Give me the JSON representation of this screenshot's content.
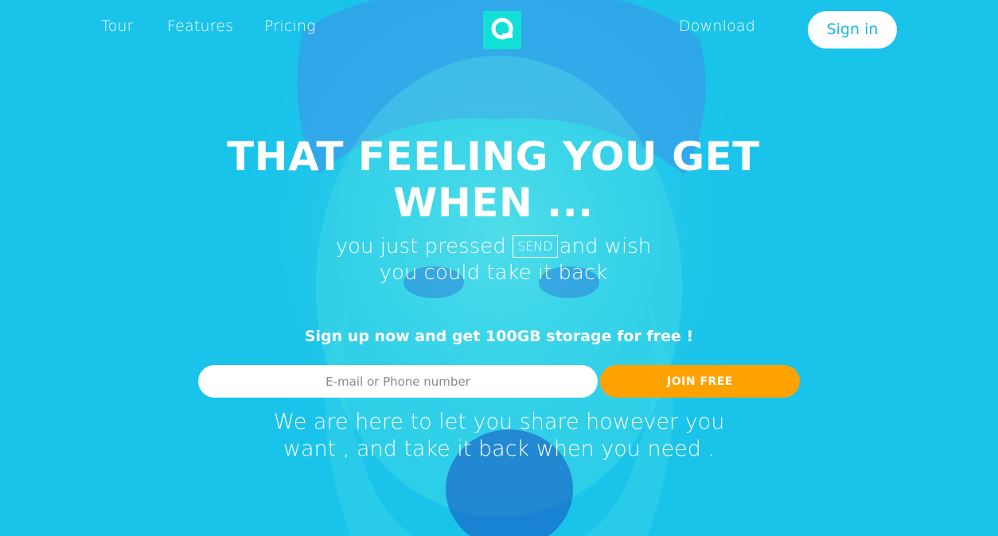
{
  "nav": {
    "tour": "Tour",
    "features": "Features",
    "pricing": "Pricing",
    "download": "Download",
    "signin": "Sign in"
  },
  "hero": {
    "headline_line1": "THAT FEELING YOU GET",
    "headline_line2": "WHEN ...",
    "sub_before": "you just pressed",
    "sub_send": "SEND",
    "sub_after": "and wish",
    "sub_line2": "you could take it back",
    "promo": "Sign up now and get 100GB storage for free !",
    "input_placeholder": "E-mail or Phone number",
    "join_label": "JOIN FREE",
    "tagline_line1": "We are here to let you share however you",
    "tagline_line2": "want , and take it back when you need ."
  },
  "colors": {
    "background": "#19c3ea",
    "logo": "#12e0d6",
    "join_button": "#ffa200",
    "signin_text": "#19b9e4"
  },
  "icons": {
    "logo": "q-logo-icon"
  }
}
